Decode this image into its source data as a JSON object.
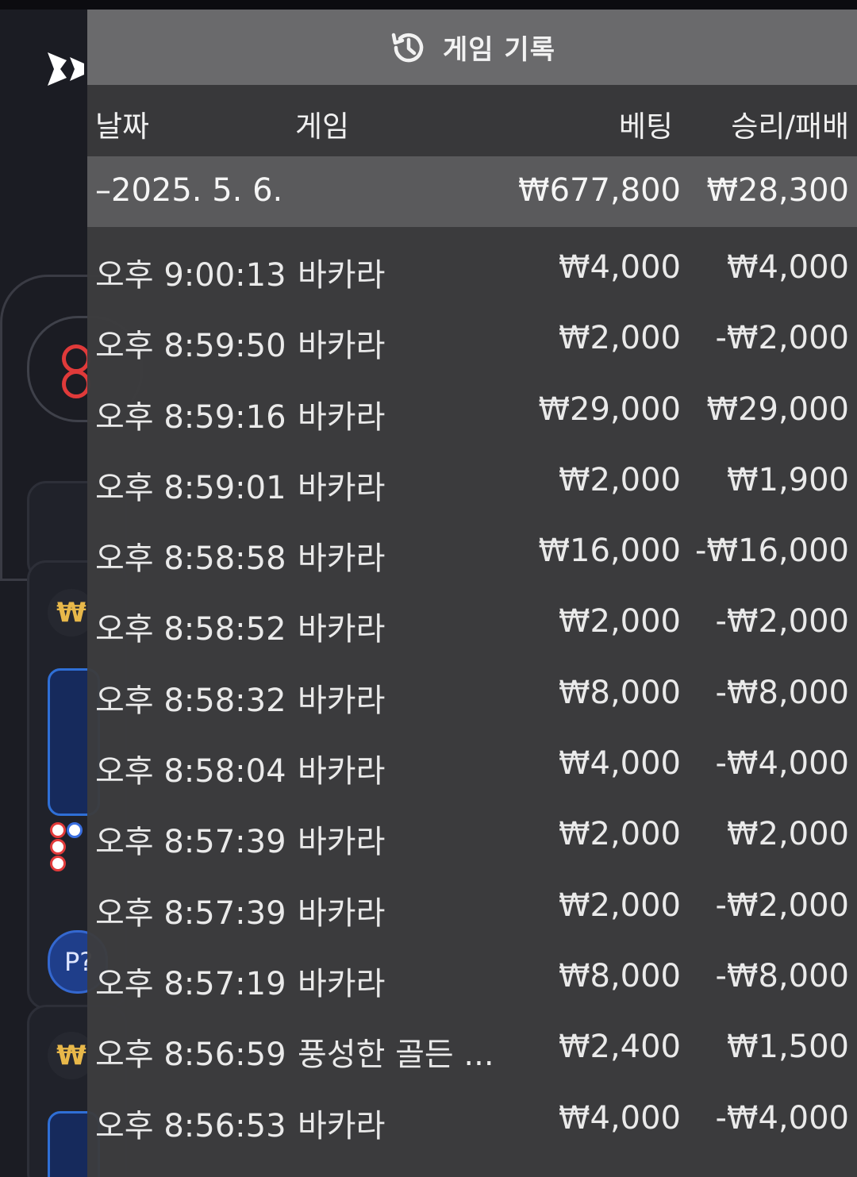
{
  "header": {
    "title": "게임 기록",
    "icon": "history-icon"
  },
  "columns": {
    "date": "날짜",
    "game": "게임",
    "bet": "베팅",
    "result": "승리/패배"
  },
  "summary": {
    "date": "–2025. 5. 6.",
    "bet": "₩677,800",
    "result": "₩28,300"
  },
  "rows": [
    {
      "time": "오후 9:00:13",
      "game": "바카라",
      "bet": "₩4,000",
      "result": "₩4,000"
    },
    {
      "time": "오후 8:59:50",
      "game": "바카라",
      "bet": "₩2,000",
      "result": "-₩2,000"
    },
    {
      "time": "오후 8:59:16",
      "game": "바카라",
      "bet": "₩29,000",
      "result": "₩29,000"
    },
    {
      "time": "오후 8:59:01",
      "game": "바카라",
      "bet": "₩2,000",
      "result": "₩1,900"
    },
    {
      "time": "오후 8:58:58",
      "game": "바카라",
      "bet": "₩16,000",
      "result": "-₩16,000"
    },
    {
      "time": "오후 8:58:52",
      "game": "바카라",
      "bet": "₩2,000",
      "result": "-₩2,000"
    },
    {
      "time": "오후 8:58:32",
      "game": "바카라",
      "bet": "₩8,000",
      "result": "-₩8,000"
    },
    {
      "time": "오후 8:58:04",
      "game": "바카라",
      "bet": "₩4,000",
      "result": "-₩4,000"
    },
    {
      "time": "오후 8:57:39",
      "game": "바카라",
      "bet": "₩2,000",
      "result": "₩2,000"
    },
    {
      "time": "오후 8:57:39",
      "game": "바카라",
      "bet": "₩2,000",
      "result": "-₩2,000"
    },
    {
      "time": "오후 8:57:19",
      "game": "바카라",
      "bet": "₩8,000",
      "result": "-₩8,000"
    },
    {
      "time": "오후 8:56:59",
      "game": "풍성한 골든 ...",
      "bet": "₩2,400",
      "result": "₩1,500"
    },
    {
      "time": "오후 8:56:53",
      "game": "바카라",
      "bet": "₩4,000",
      "result": "-₩4,000"
    }
  ],
  "background": {
    "won_symbol": "₩",
    "p_button": "P?",
    "colors": {
      "accent_red": "#e03a3a",
      "accent_blue": "#2f6fd6",
      "won_gold": "#e8b84a"
    }
  }
}
